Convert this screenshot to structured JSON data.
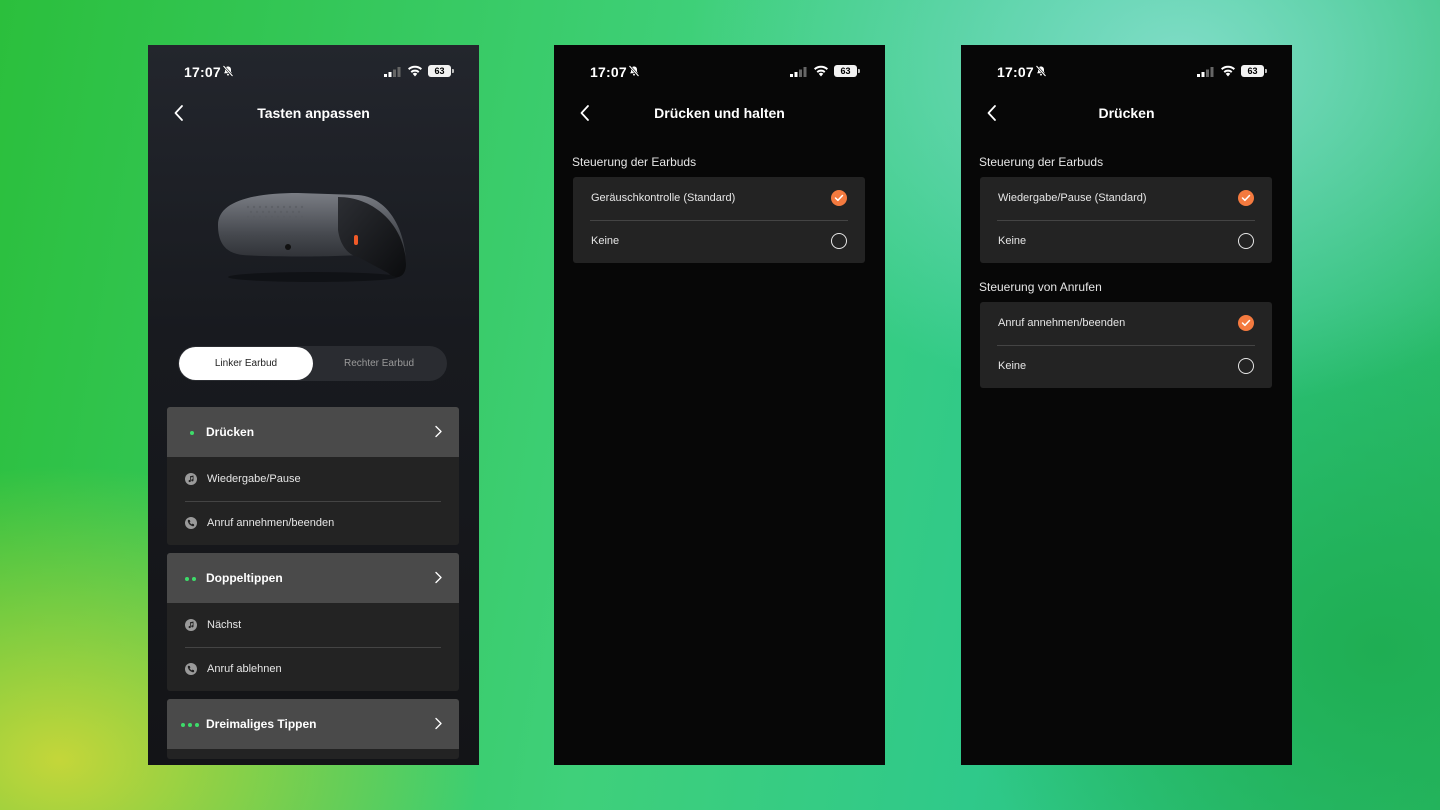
{
  "status_bar": {
    "time": "17:07",
    "battery": "63"
  },
  "screen1": {
    "title": "Tasten anpassen",
    "segmented": {
      "left": "Linker Earbud",
      "right": "Rechter Earbud",
      "selected": "left"
    },
    "groups": [
      {
        "title": "Drücken",
        "dots": 1,
        "rows": [
          {
            "icon": "music-note-icon",
            "label": "Wiedergabe/Pause"
          },
          {
            "icon": "phone-icon",
            "label": "Anruf annehmen/beenden"
          }
        ]
      },
      {
        "title": "Doppeltippen",
        "dots": 2,
        "rows": [
          {
            "icon": "music-note-icon",
            "label": "Nächst"
          },
          {
            "icon": "phone-icon",
            "label": "Anruf ablehnen"
          }
        ]
      },
      {
        "title": "Dreimaliges Tippen",
        "dots": 3,
        "rows": []
      }
    ]
  },
  "screen2": {
    "title": "Drücken und halten",
    "sections": [
      {
        "title": "Steuerung der Earbuds",
        "options": [
          {
            "label": "Geräuschkontrolle (Standard)",
            "selected": true
          },
          {
            "label": "Keine",
            "selected": false
          }
        ]
      }
    ]
  },
  "screen3": {
    "title": "Drücken",
    "sections": [
      {
        "title": "Steuerung der Earbuds",
        "options": [
          {
            "label": "Wiedergabe/Pause (Standard)",
            "selected": true
          },
          {
            "label": "Keine",
            "selected": false
          }
        ]
      },
      {
        "title": "Steuerung von Anrufen",
        "options": [
          {
            "label": "Anruf annehmen/beenden",
            "selected": true
          },
          {
            "label": "Keine",
            "selected": false
          }
        ]
      }
    ]
  },
  "colors": {
    "accent": "#f47a3f",
    "dot": "#3ddc6a",
    "panel": "#232323",
    "header": "#4a4a4a"
  }
}
